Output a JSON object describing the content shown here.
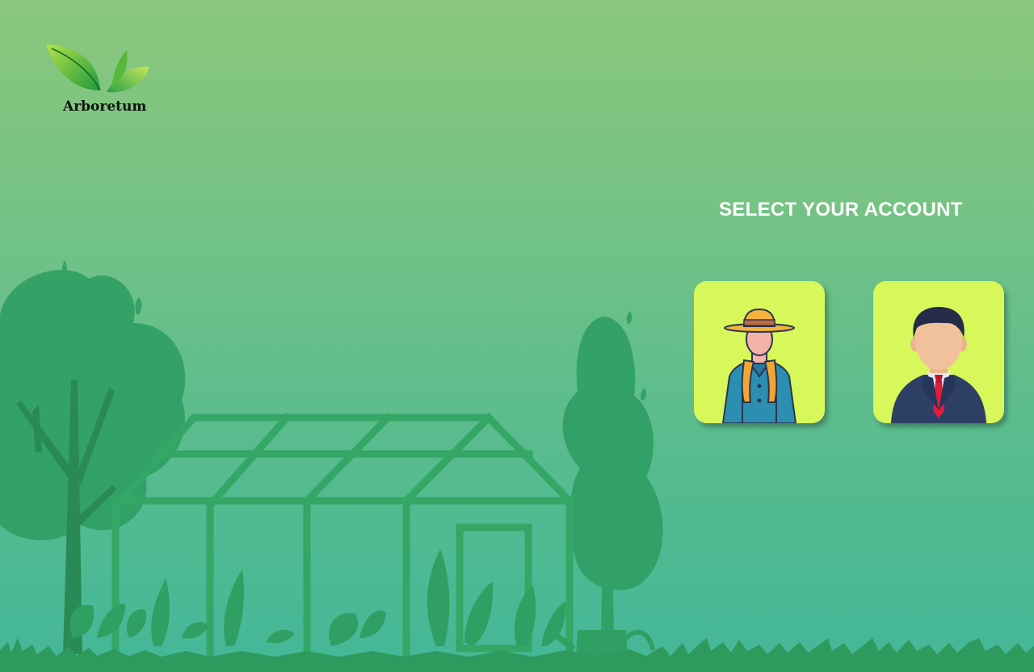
{
  "app": {
    "logo_text": "Arboretum"
  },
  "account_select": {
    "heading": "SELECT YOUR ACCOUNT",
    "accounts": [
      {
        "id": "farmer",
        "icon": "farmer-avatar-icon"
      },
      {
        "id": "manager",
        "icon": "businessman-avatar-icon"
      }
    ]
  },
  "colors": {
    "background_top": "#8bc77c",
    "background_bottom": "#43b898",
    "card": "#d7f75a",
    "silhouette": "#2e9e62"
  }
}
